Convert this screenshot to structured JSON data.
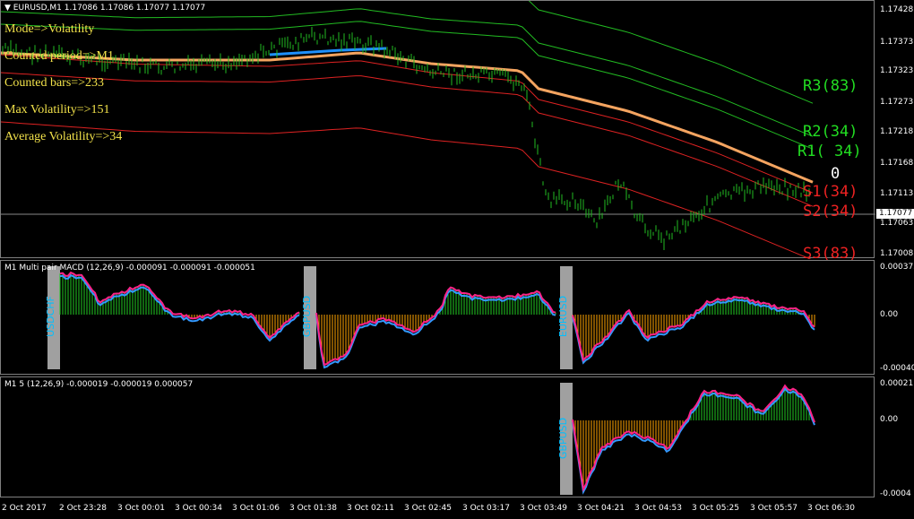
{
  "main": {
    "title": "EURUSD,M1  1.17086 1.17086 1.17077 1.17077",
    "info": [
      "Mode=>Volatility",
      "Counted period=>M1",
      "Counted bars=>233",
      "Max Volatility=>151",
      "Average Volatility=>34"
    ],
    "levels": [
      {
        "text": "R3(83)",
        "color": "#22dd22"
      },
      {
        "text": "R2(34)",
        "color": "#22dd22"
      },
      {
        "text": "R1( 34)",
        "color": "#22dd22"
      },
      {
        "text": "0",
        "color": "#ffffff"
      },
      {
        "text": "S1(34)",
        "color": "#ee2222"
      },
      {
        "text": "S2(34)",
        "color": "#ee2222"
      },
      {
        "text": "S3(83)",
        "color": "#ee2222"
      }
    ],
    "price_axis": [
      "1.17428",
      "1.17373",
      "1.17323",
      "1.17273",
      "1.17218",
      "1.17168",
      "1.17113",
      "1.17063",
      "1.17008"
    ],
    "current_price": "1.17077"
  },
  "macd": {
    "title": "M1 Multi pair MACD (12,26,9) -0.000091 -0.000091 -0.000051",
    "axis": [
      "0.000373",
      "0.00",
      "-0.000407"
    ],
    "pair_labels": [
      "USDCHF",
      "GBPUSD",
      "EURUSD"
    ]
  },
  "m5": {
    "title": "M1 5 (12,26,9) -0.000019 -0.000019 0.000057",
    "axis": [
      "0.000211",
      "0.00",
      "-0.0004"
    ],
    "pair_labels": [
      "GBPUSD"
    ]
  },
  "time_axis": [
    "2 Oct 2017",
    "2 Oct 23:28",
    "3 Oct 00:01",
    "3 Oct 00:34",
    "3 Oct 01:06",
    "3 Oct 01:38",
    "3 Oct 02:11",
    "3 Oct 02:45",
    "3 Oct 03:17",
    "3 Oct 03:49",
    "3 Oct 04:21",
    "3 Oct 04:53",
    "3 Oct 05:25",
    "3 Oct 05:57",
    "3 Oct 06:30"
  ],
  "colors": {
    "candles": "#22bb22",
    "pivot_line": "#f4a460",
    "highlight": "#1e90ff",
    "green_band": "#22bb22",
    "red_band": "#dd2222",
    "hist_up": "#22cc22",
    "hist_down": "#ffa500",
    "macd_line": "#ff2288",
    "signal_line": "#3399ff",
    "pair_box": "#a0a0a0",
    "pair_text": "#00bfff"
  }
}
